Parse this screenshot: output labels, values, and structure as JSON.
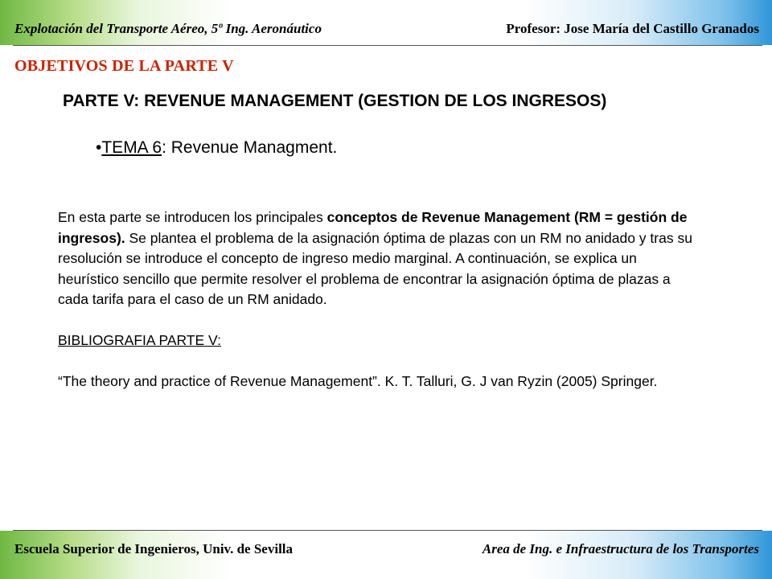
{
  "header": {
    "left": "Explotación del Transporte Aéreo, 5º Ing. Aeronáutico",
    "right": "Profesor: Jose María del Castillo Granados"
  },
  "footer": {
    "left": "Escuela  Superior de Ingenieros, Univ. de Sevilla",
    "right": "Area de Ing. e Infraestructura de los Transportes"
  },
  "section_title": "OBJETIVOS DE LA PARTE V",
  "main_heading": "PARTE V: REVENUE MANAGEMENT (GESTION DE LOS INGRESOS)",
  "topic": {
    "bullet": "•",
    "label": "TEMA 6",
    "text": ": Revenue Managment."
  },
  "body": {
    "intro": "En esta parte se introducen los principales ",
    "intro_bold": "conceptos de Revenue Management (RM = gestión de ingresos).",
    "intro_rest": " Se plantea el problema de la asignación óptima de plazas con un RM no anidado y tras su resolución se introduce el concepto de ingreso medio marginal. A continuación,  se explica un heurístico sencillo que permite resolver el problema  de encontrar la asignación óptima de plazas a cada tarifa para el caso de un RM anidado.",
    "bib_title": "BIBLIOGRAFIA PARTE V:",
    "bib_entry": "“The theory and practice of Revenue Management”. K. T. Talluri, G. J van Ryzin (2005) Springer."
  },
  "colors": {
    "accent_title": "#cc2200",
    "band_green": "#6fb844",
    "band_blue": "#2f96d8"
  }
}
